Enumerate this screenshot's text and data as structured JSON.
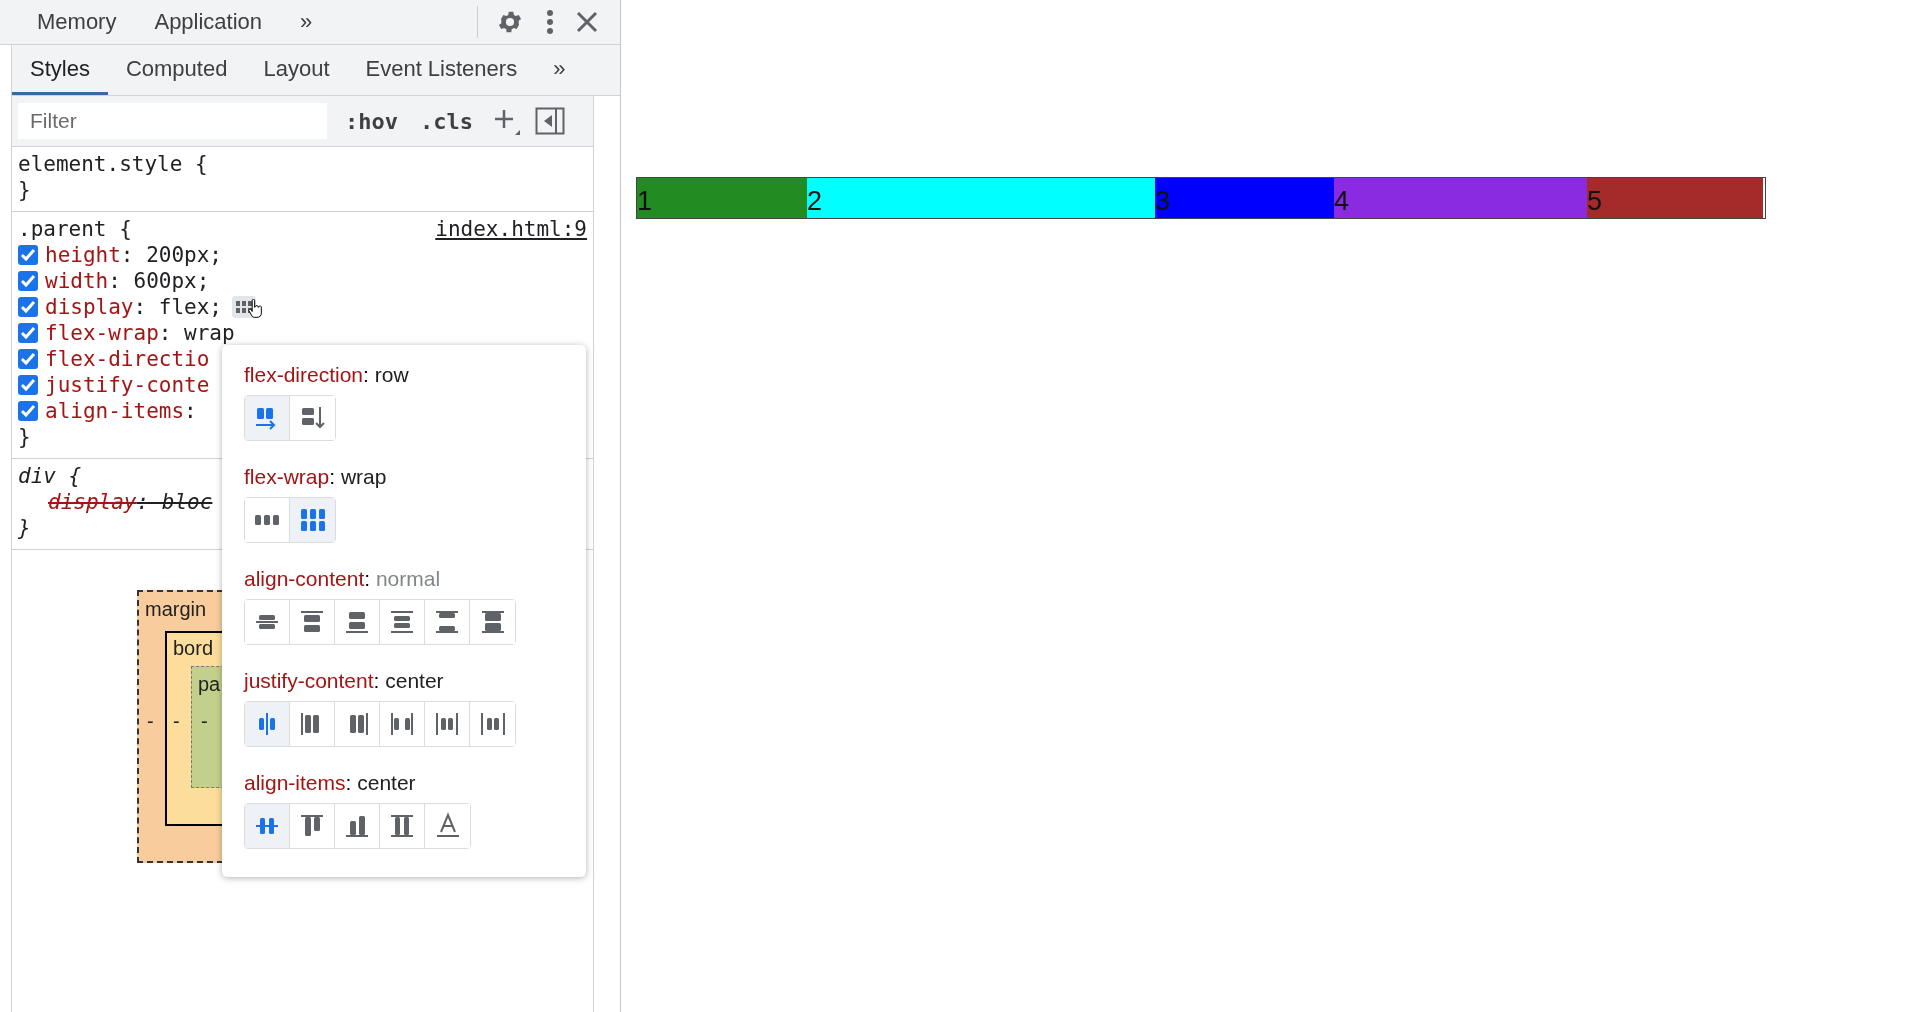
{
  "top_tabs": [
    {
      "label": "Memory"
    },
    {
      "label": "Application"
    },
    {
      "label": "»"
    }
  ],
  "sub_tabs": [
    {
      "label": "Styles",
      "selected": true
    },
    {
      "label": "Computed",
      "selected": false
    },
    {
      "label": "Layout",
      "selected": false
    },
    {
      "label": "Event Listeners",
      "selected": false
    },
    {
      "label": "»",
      "selected": false
    }
  ],
  "filter": {
    "placeholder": "Filter",
    "hov": ":hov",
    "cls": ".cls"
  },
  "rules": [
    {
      "selector": "element.style {",
      "italic": false,
      "close": "}"
    },
    {
      "selector": ".parent {",
      "source": "index.html:9",
      "italic": false,
      "properties": [
        {
          "name": "height",
          "value": ": 200px;",
          "checked": true,
          "struck": false
        },
        {
          "name": "width",
          "value": ": 600px;",
          "checked": true,
          "struck": false
        },
        {
          "name": "display",
          "value": ": flex;",
          "checked": true,
          "struck": false,
          "flex_editor": true
        },
        {
          "name": "flex-wrap",
          "value": ": wrap",
          "checked": true,
          "struck": false
        },
        {
          "name": "flex-directio",
          "checked": true,
          "struck": false
        },
        {
          "name": "justify-conte",
          "checked": true,
          "struck": false
        },
        {
          "name": "align-items",
          "value": ":",
          "checked": true,
          "struck": false
        }
      ],
      "close": "}"
    },
    {
      "selector": "div {",
      "italic": true,
      "properties": [
        {
          "name": "display",
          "value": ": bloc",
          "checked": false,
          "struck": true
        }
      ],
      "close": "}"
    }
  ],
  "box_model": {
    "margin": "margin",
    "border": "bord",
    "padding": "pa",
    "dash": "-"
  },
  "flex_editor": {
    "sections": [
      {
        "kind": "direction",
        "property": "flex-direction",
        "colon": ":",
        "value": "row",
        "dim": false,
        "options": [
          {
            "kind": "row",
            "selected": true
          },
          {
            "kind": "column",
            "selected": false
          }
        ]
      },
      {
        "kind": "wrap",
        "property": "flex-wrap",
        "colon": ":",
        "value": "wrap",
        "dim": false,
        "options": [
          {
            "kind": "nowrap",
            "selected": false
          },
          {
            "kind": "wrap",
            "selected": true
          }
        ]
      },
      {
        "kind": "align-content",
        "property": "align-content",
        "colon": ":",
        "value": "normal",
        "dim": true,
        "options": [
          {
            "kind": "center",
            "selected": false
          },
          {
            "kind": "start",
            "selected": false
          },
          {
            "kind": "end",
            "selected": false
          },
          {
            "kind": "around",
            "selected": false
          },
          {
            "kind": "between",
            "selected": false
          },
          {
            "kind": "stretch",
            "selected": false
          }
        ]
      },
      {
        "kind": "justify",
        "property": "justify-content",
        "colon": ":",
        "value": "center",
        "dim": false,
        "options": [
          {
            "kind": "center",
            "selected": true
          },
          {
            "kind": "start",
            "selected": false
          },
          {
            "kind": "end",
            "selected": false
          },
          {
            "kind": "between",
            "selected": false
          },
          {
            "kind": "around",
            "selected": false
          },
          {
            "kind": "evenly",
            "selected": false
          }
        ]
      },
      {
        "kind": "align-items",
        "property": "align-items",
        "colon": ":",
        "value": "center",
        "dim": false,
        "options": [
          {
            "kind": "center",
            "selected": true
          },
          {
            "kind": "start",
            "selected": false
          },
          {
            "kind": "end",
            "selected": false
          },
          {
            "kind": "stretch",
            "selected": false
          },
          {
            "kind": "baseline",
            "selected": false
          }
        ]
      }
    ]
  },
  "boxes": [
    {
      "label": "1",
      "color": "#228b22"
    },
    {
      "label": "2",
      "color": "#00ffff"
    },
    {
      "label": "3",
      "color": "#0000ff"
    },
    {
      "label": "4",
      "color": "#8a2be2"
    },
    {
      "label": "5",
      "color": "#a52a2a"
    }
  ]
}
